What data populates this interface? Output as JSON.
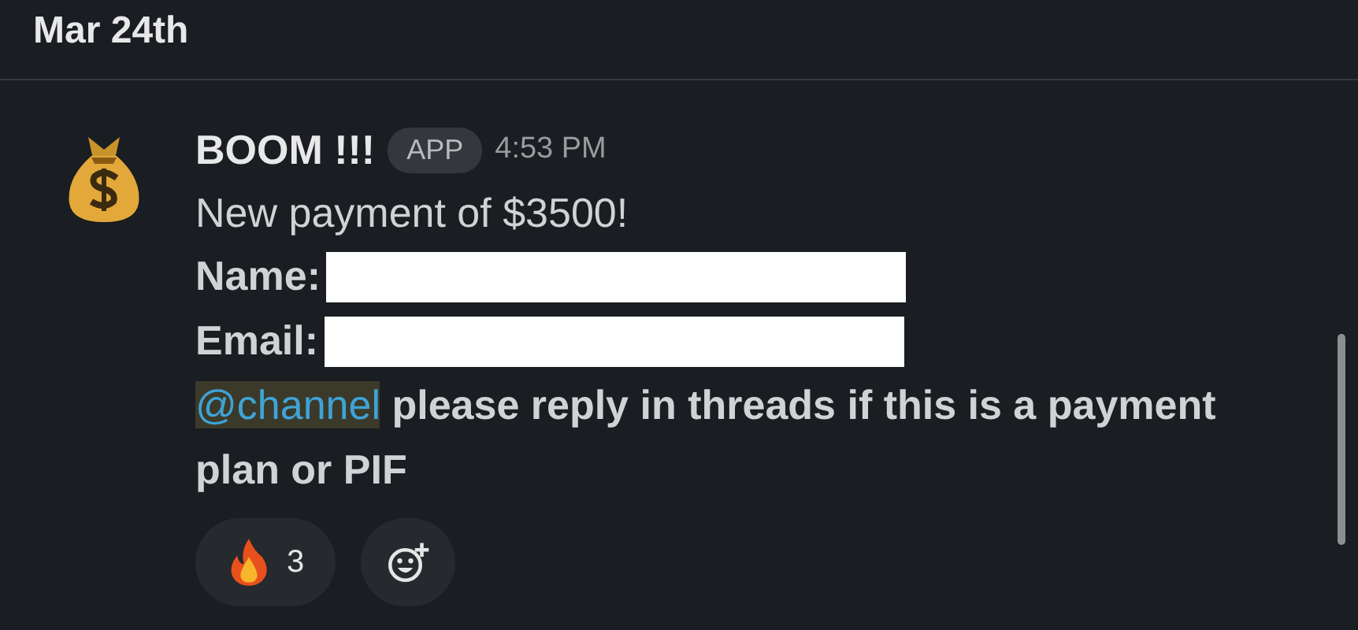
{
  "date_divider": "Mar 24th",
  "message": {
    "sender": "BOOM !!!",
    "badge": "APP",
    "time": "4:53 PM",
    "text": "New payment of $3500!",
    "fields": [
      {
        "label": "Name:"
      },
      {
        "label": "Email:"
      }
    ],
    "mention": "@channel",
    "mention_text": "please reply in threads if this is a payment plan or PIF",
    "reactions": [
      {
        "kind": "fire",
        "count": "3"
      },
      {
        "kind": "add"
      }
    ]
  }
}
